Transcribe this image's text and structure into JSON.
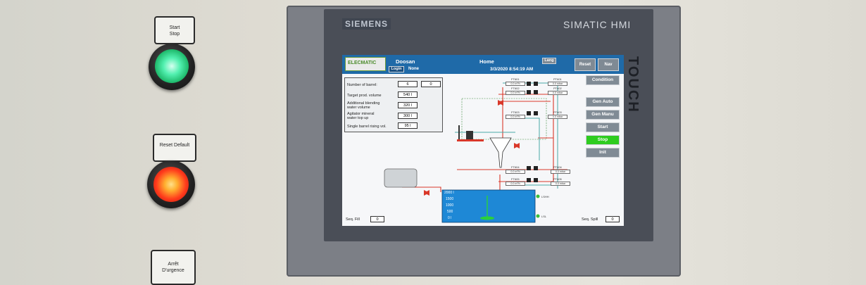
{
  "panel": {
    "start_stop_label": "Start\nStop",
    "reset_default_label": "Reset Default",
    "emergency_label": "Arrêt\nD'urgence",
    "lamp_green": "#2fe08a",
    "lamp_red": "#ff3b1f"
  },
  "device": {
    "brand": "SIEMENS",
    "model": "SIMATIC HMI",
    "touch": "TOUCH"
  },
  "hmi": {
    "logo": "ELECMATIC",
    "customer": "Doosan",
    "page_title": "Home",
    "lang_label": "Lang",
    "login_label": "Login",
    "user": "None",
    "datetime": "3/3/2020 8:54:19 AM",
    "reset_label": "Reset",
    "nav_label": "Nav",
    "side_buttons": [
      {
        "label": "Condition"
      },
      {
        "label": "Gen Auto"
      },
      {
        "label": "Gen Manu"
      },
      {
        "label": "Start"
      },
      {
        "label": "Stop"
      },
      {
        "label": "Init"
      }
    ],
    "params": [
      {
        "label": "Number of barrel:",
        "value": "6",
        "value2": "0"
      },
      {
        "label": "Target prod. volume",
        "value": "540 l"
      },
      {
        "label": "Additional blending\nwater volume",
        "value": "320 l"
      },
      {
        "label": "Agitator mineral\nwater top up",
        "value": "300 l"
      },
      {
        "label": "Single barrel rising vol.",
        "value": "95 l"
      }
    ],
    "tags": [
      {
        "name": "FT601",
        "value": "0.0 m³/h"
      },
      {
        "name": "PT601",
        "value": "0.0 mbar"
      },
      {
        "name": "FT602",
        "value": "0.0 m³/h"
      },
      {
        "name": "PT602",
        "value": "0.0 mbar"
      },
      {
        "name": "FT603",
        "value": "0.0 m³/h"
      },
      {
        "name": "PT603",
        "value": "0.0 mbar"
      },
      {
        "name": "FT604",
        "value": "0.0 m³/h"
      },
      {
        "name": "PT604",
        "value": "0.0 mbar"
      },
      {
        "name": "FT605",
        "value": "0.0 m³/h"
      },
      {
        "name": "PT605",
        "value": "0.0 mbar"
      }
    ],
    "tank_scale": [
      "2000 l",
      "1500",
      "1000",
      "500",
      "0 l"
    ],
    "level_high": "LSHH",
    "level_low": "LSL",
    "seq_fill_label": "Seq. Fill",
    "seq_fill_value": "0",
    "seq_spill_label": "Seq. Spill",
    "seq_spill_value": "0",
    "colors": {
      "header": "#1f6aa8",
      "button": "#808b95",
      "stop_active": "#2ecc1f",
      "pipe_red": "#d9382a",
      "pipe_teal": "#4aa8a8",
      "tank_water": "#1e88d6"
    }
  }
}
